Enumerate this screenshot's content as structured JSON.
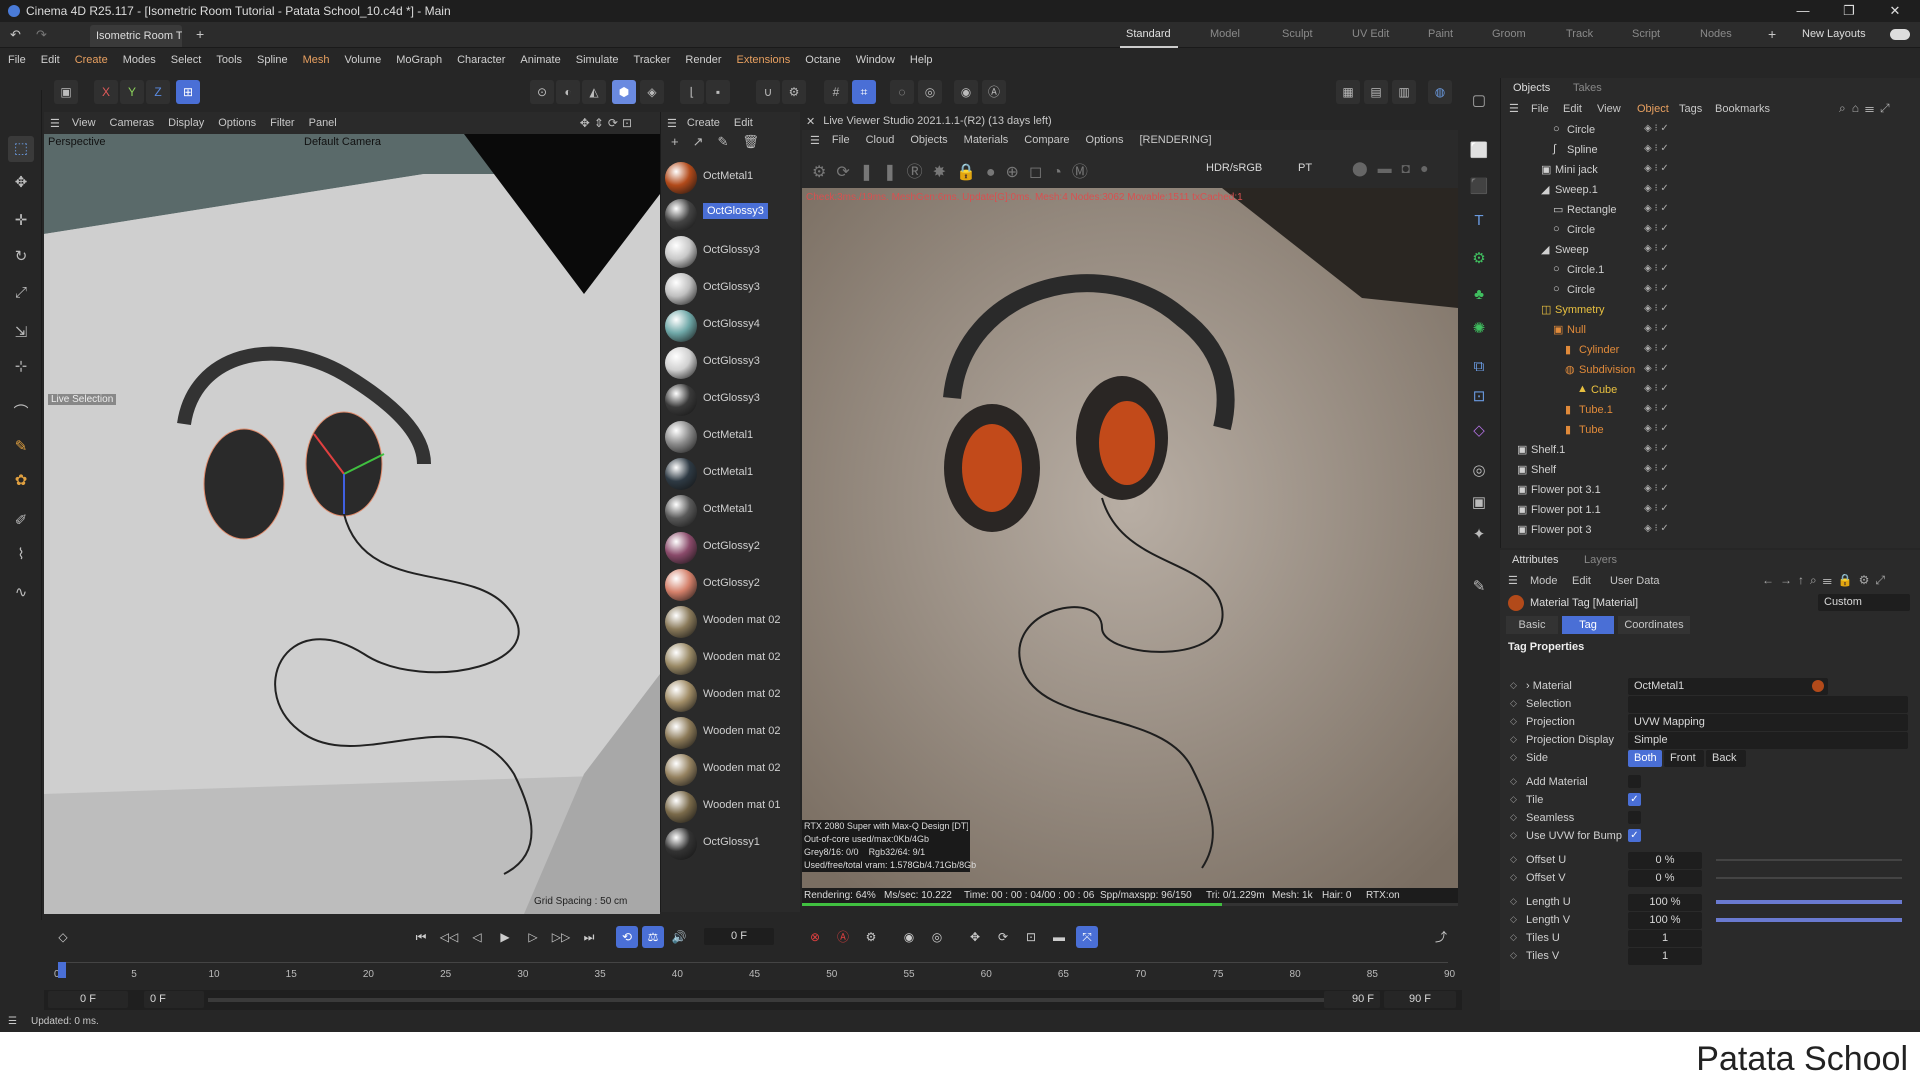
{
  "window": {
    "title": "Cinema 4D R25.117 - [Isometric Room Tutorial - Patata School_10.c4d *] - Main"
  },
  "tabs": {
    "doc_tab": "Isometric Room T...",
    "layouts": [
      "Standard",
      "Model",
      "Sculpt",
      "UV Edit",
      "Paint",
      "Groom",
      "Track",
      "Script",
      "Nodes"
    ],
    "new_layouts": "New Layouts"
  },
  "menu": [
    "File",
    "Edit",
    "Create",
    "Modes",
    "Select",
    "Tools",
    "Spline",
    "Mesh",
    "Volume",
    "MoGraph",
    "Character",
    "Animate",
    "Simulate",
    "Tracker",
    "Render",
    "Extensions",
    "Octane",
    "Window",
    "Help"
  ],
  "axes": {
    "x": "X",
    "y": "Y",
    "z": "Z"
  },
  "viewport": {
    "menu": [
      "View",
      "Cameras",
      "Display",
      "Options",
      "Filter",
      "Panel"
    ],
    "label": "Perspective",
    "camera": "Default Camera",
    "live_selection": "Live Selection",
    "grid_spacing": "Grid Spacing : 50 cm"
  },
  "materials": {
    "menu": [
      "Create",
      "Edit"
    ],
    "items": [
      {
        "name": "OctMetal1",
        "color": "#b24a1a"
      },
      {
        "name": "OctGlossy3",
        "color": "#444444",
        "selected": true
      },
      {
        "name": "OctGlossy3",
        "color": "#c8c8c8"
      },
      {
        "name": "OctGlossy3",
        "color": "#c0c0c0"
      },
      {
        "name": "OctGlossy4",
        "color": "#6fa8a8"
      },
      {
        "name": "OctGlossy3",
        "color": "#d0d0d0"
      },
      {
        "name": "OctGlossy3",
        "color": "#3a3a3a"
      },
      {
        "name": "OctMetal1",
        "color": "#8a8a8a"
      },
      {
        "name": "OctMetal1",
        "color": "#2e3a44"
      },
      {
        "name": "OctMetal1",
        "color": "#5a5a5a"
      },
      {
        "name": "OctGlossy2",
        "color": "#8a4a6a"
      },
      {
        "name": "OctGlossy2",
        "color": "#d4806a"
      },
      {
        "name": "Wooden mat 02",
        "color": "#8a7a5a"
      },
      {
        "name": "Wooden mat 02",
        "color": "#9a8a66"
      },
      {
        "name": "Wooden mat 02",
        "color": "#a08c66"
      },
      {
        "name": "Wooden mat 02",
        "color": "#8c7a58"
      },
      {
        "name": "Wooden mat 02",
        "color": "#958260"
      },
      {
        "name": "Wooden mat 01",
        "color": "#7a6a4a"
      },
      {
        "name": "OctGlossy1",
        "color": "#333333"
      }
    ]
  },
  "liveviewer": {
    "title": "Live Viewer Studio 2021.1.1-(R2) (13 days left)",
    "menu": [
      "File",
      "Cloud",
      "Objects",
      "Materials",
      "Compare",
      "Options"
    ],
    "status_tag": "[RENDERING]",
    "colorspace": "HDR/sRGB",
    "mode": "PT",
    "top_info": "Check:3ms./19ms. MeshGen:6ms. Update[G]:0ms. Mesh:4 Nodes:3062 Movable:1511 txCached:1",
    "gpu": "RTX 2080 Super with Max-Q Design [DT][7.5]",
    "outofcore": "Out-of-core used/max:0Kb/4Gb",
    "grey": "Grey8/16: 0/0",
    "rgb": "Rgb32/64: 9/1",
    "vram": "Used/free/total vram: 1.578Gb/4.71Gb/8Gb",
    "rendering": "Rendering: 64%",
    "mssec": "Ms/sec: 10.222",
    "time": "Time: 00 : 00 : 04/00 : 00 : 06",
    "spp": "Spp/maxspp: 96/150",
    "tri": "Tri: 0/1.229m",
    "mesh": "Mesh: 1k",
    "hair": "Hair: 0",
    "rtx": "RTX:on",
    "progress": 0.64
  },
  "objects": {
    "tabs": [
      "Objects",
      "Takes"
    ],
    "menu": [
      "File",
      "Edit",
      "View",
      "Object",
      "Tags",
      "Bookmarks"
    ],
    "rows": [
      {
        "name": "Circle",
        "indent": 3,
        "icon": "circle",
        "color": "#d0d0d0"
      },
      {
        "name": "Spline",
        "indent": 3,
        "icon": "spline",
        "color": "#d0d0d0"
      },
      {
        "name": "Mini jack",
        "indent": 2,
        "icon": "null",
        "color": "#d0d0d0"
      },
      {
        "name": "Sweep.1",
        "indent": 2,
        "icon": "sweep",
        "color": "#d0d0d0"
      },
      {
        "name": "Rectangle",
        "indent": 3,
        "icon": "rect",
        "color": "#d0d0d0"
      },
      {
        "name": "Circle",
        "indent": 3,
        "icon": "circle",
        "color": "#d0d0d0"
      },
      {
        "name": "Sweep",
        "indent": 2,
        "icon": "sweep",
        "color": "#d0d0d0"
      },
      {
        "name": "Circle.1",
        "indent": 3,
        "icon": "circle",
        "color": "#d0d0d0"
      },
      {
        "name": "Circle",
        "indent": 3,
        "icon": "circle",
        "color": "#d0d0d0"
      },
      {
        "name": "Symmetry",
        "indent": 2,
        "icon": "symmetry",
        "color": "#e8c040"
      },
      {
        "name": "Null",
        "indent": 3,
        "icon": "null",
        "color": "#e08a3a"
      },
      {
        "name": "Cylinder",
        "indent": 4,
        "icon": "cyl",
        "color": "#e08a3a"
      },
      {
        "name": "Subdivision",
        "indent": 4,
        "icon": "subd",
        "color": "#e08a3a"
      },
      {
        "name": "Cube",
        "indent": 5,
        "icon": "cube",
        "color": "#e8c040"
      },
      {
        "name": "Tube.1",
        "indent": 4,
        "icon": "tube",
        "color": "#e08a3a"
      },
      {
        "name": "Tube",
        "indent": 4,
        "icon": "tube",
        "color": "#e08a3a"
      },
      {
        "name": "Shelf.1",
        "indent": 0,
        "icon": "null",
        "color": "#d0d0d0"
      },
      {
        "name": "Shelf",
        "indent": 0,
        "icon": "null",
        "color": "#d0d0d0"
      },
      {
        "name": "Flower pot 3.1",
        "indent": 0,
        "icon": "null",
        "color": "#d0d0d0"
      },
      {
        "name": "Flower pot 1.1",
        "indent": 0,
        "icon": "null",
        "color": "#d0d0d0"
      },
      {
        "name": "Flower pot 3",
        "indent": 0,
        "icon": "null",
        "color": "#d0d0d0"
      }
    ]
  },
  "attributes": {
    "tabs": [
      "Attributes",
      "Layers"
    ],
    "menu": [
      "Mode",
      "Edit",
      "User Data"
    ],
    "header": "Material Tag [Material]",
    "preset": "Custom",
    "subtabs": [
      "Basic",
      "Tag",
      "Coordinates"
    ],
    "section": "Tag Properties",
    "material_label": "Material",
    "material_value": "OctMetal1",
    "selection_label": "Selection",
    "projection_label": "Projection",
    "projection_value": "UVW Mapping",
    "projection_display_label": "Projection Display",
    "projection_display_value": "Simple",
    "side_label": "Side",
    "side_options": [
      "Both",
      "Front",
      "Back"
    ],
    "add_material_label": "Add Material",
    "tile_label": "Tile",
    "seamless_label": "Seamless",
    "use_uvw_label": "Use UVW for Bump",
    "offset_u_label": "Offset U",
    "offset_u_value": "0 %",
    "offset_v_label": "Offset V",
    "offset_v_value": "0 %",
    "length_u_label": "Length U",
    "length_u_value": "100 %",
    "length_v_label": "Length V",
    "length_v_value": "100 %",
    "tiles_u_label": "Tiles U",
    "tiles_u_value": "1",
    "tiles_v_label": "Tiles V",
    "tiles_v_value": "1"
  },
  "timeline": {
    "frame_field": "0 F",
    "ticks": [
      "0",
      "5",
      "10",
      "15",
      "20",
      "25",
      "30",
      "35",
      "40",
      "45",
      "50",
      "55",
      "60",
      "65",
      "70",
      "75",
      "80",
      "85",
      "90"
    ],
    "start": "0 F",
    "start2": "0 F",
    "end": "90 F",
    "end2": "90 F"
  },
  "status": {
    "message": "Updated: 0 ms."
  },
  "brand": "Patata School"
}
